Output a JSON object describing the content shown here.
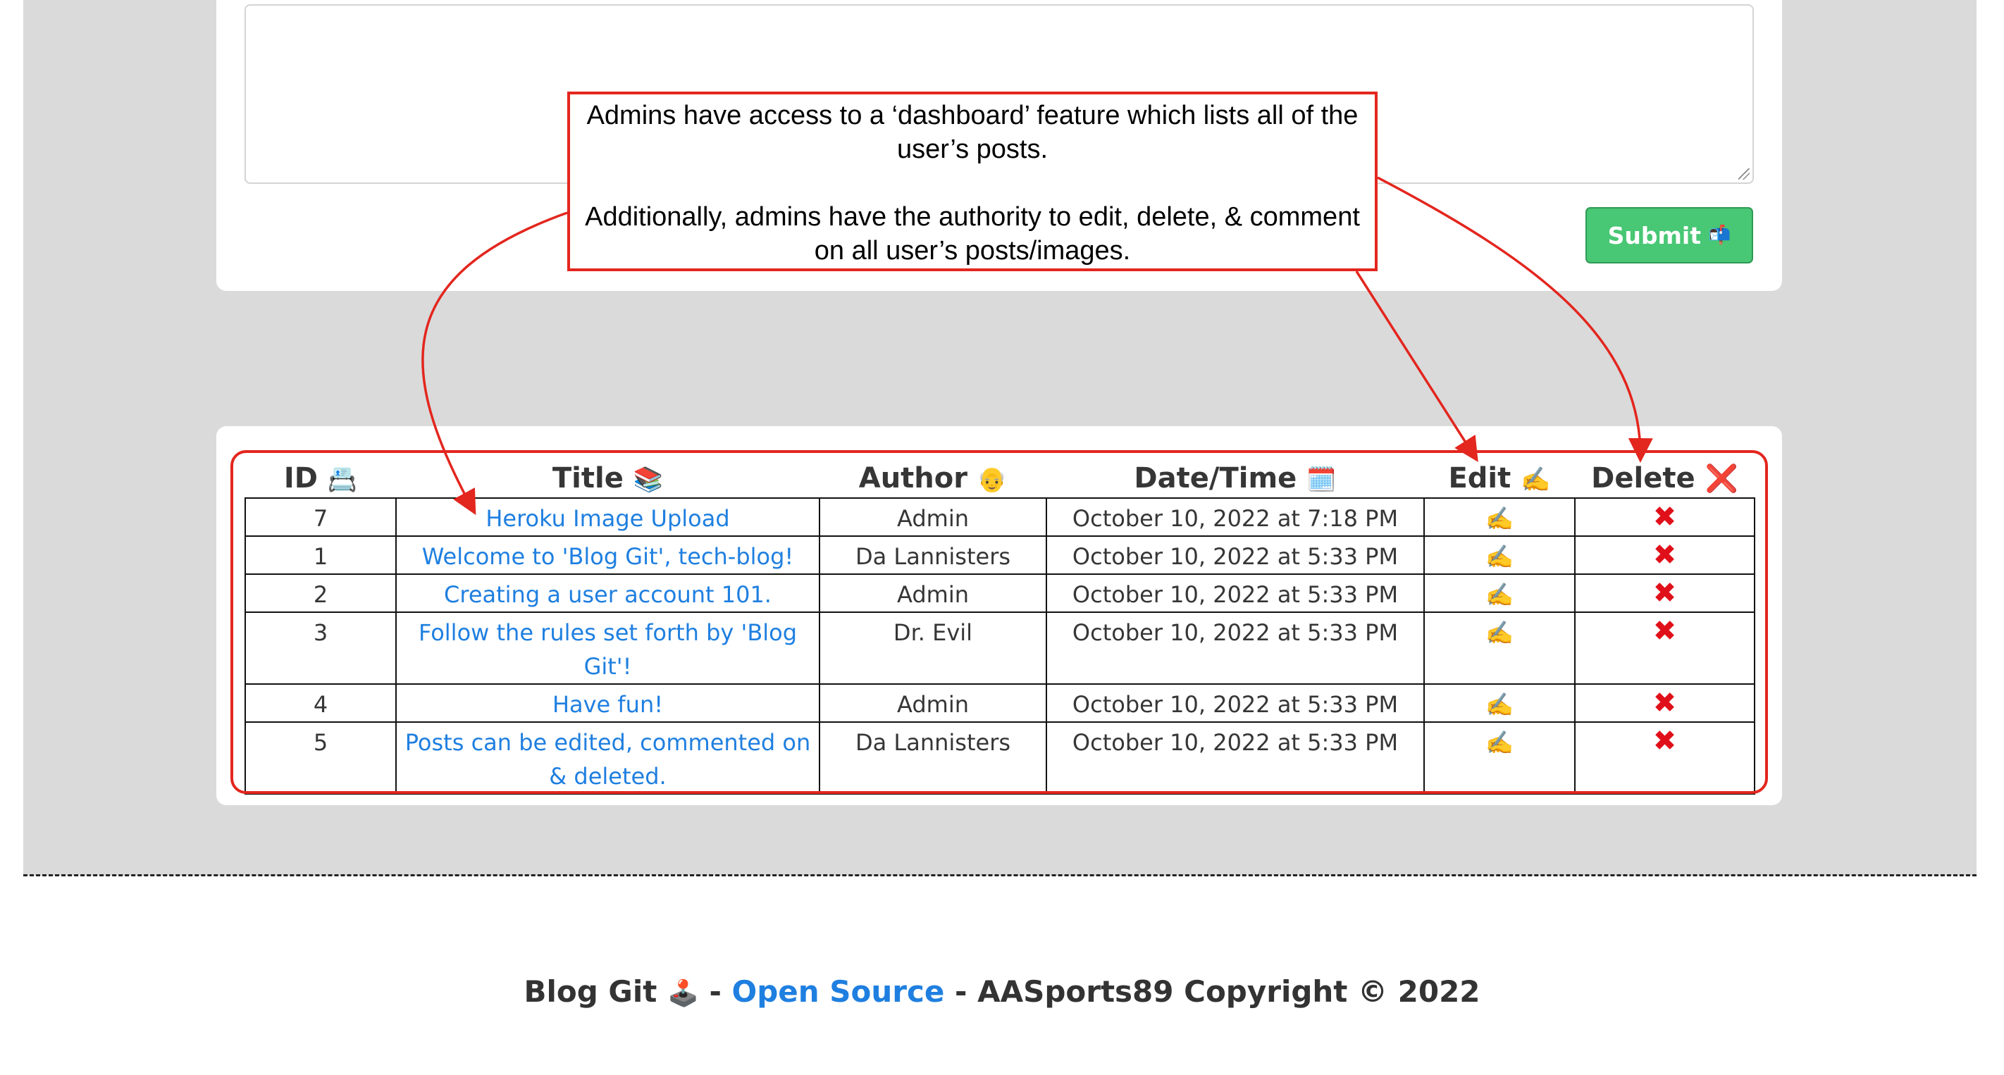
{
  "form": {
    "textarea_value": "",
    "submit_label": "Submit",
    "submit_icon": "📬"
  },
  "callout": {
    "paragraph1": "Admins have access to a ‘dashboard’ feature which lists all of the user’s posts.",
    "paragraph2": "Additionally, admins have the authority to edit, delete, & comment on all user’s posts/images."
  },
  "table": {
    "headers": [
      {
        "label": "ID",
        "icon": "📇"
      },
      {
        "label": "Title",
        "icon": "📚"
      },
      {
        "label": "Author",
        "icon": "👴"
      },
      {
        "label": "Date/Time",
        "icon": "🗓️"
      },
      {
        "label": "Edit",
        "icon": "✍️"
      },
      {
        "label": "Delete",
        "icon": "❌"
      }
    ],
    "rows": [
      {
        "id": "7",
        "title": "Heroku Image Upload",
        "author": "Admin",
        "datetime": "October 10, 2022 at 7:18 PM",
        "edit": "✍️",
        "delete": "✖"
      },
      {
        "id": "1",
        "title": "Welcome to 'Blog Git', tech-blog!",
        "author": "Da Lannisters",
        "datetime": "October 10, 2022 at 5:33 PM",
        "edit": "✍️",
        "delete": "✖"
      },
      {
        "id": "2",
        "title": "Creating a user account 101.",
        "author": "Admin",
        "datetime": "October 10, 2022 at 5:33 PM",
        "edit": "✍️",
        "delete": "✖"
      },
      {
        "id": "3",
        "title": "Follow the rules set forth by 'Blog Git'!",
        "author": "Dr. Evil",
        "datetime": "October 10, 2022 at 5:33 PM",
        "edit": "✍️",
        "delete": "✖"
      },
      {
        "id": "4",
        "title": "Have fun!",
        "author": "Admin",
        "datetime": "October 10, 2022 at 5:33 PM",
        "edit": "✍️",
        "delete": "✖"
      },
      {
        "id": "5",
        "title": "Posts can be edited, commented on & deleted.",
        "author": "Da Lannisters",
        "datetime": "October 10, 2022 at 5:33 PM",
        "edit": "✍️",
        "delete": "✖"
      }
    ]
  },
  "footer": {
    "brand": "Blog Git",
    "brand_icon": "🕹️",
    "separator1": "-",
    "link_label": "Open Source",
    "separator2": "-",
    "copyright": "AASports89 Copyright © 2022"
  },
  "colors": {
    "page_background": "#dadada",
    "submit_green": "#48c774",
    "link_blue": "#1f7fe0",
    "annotation_red": "#e3261e",
    "delete_red": "#e0101a"
  }
}
